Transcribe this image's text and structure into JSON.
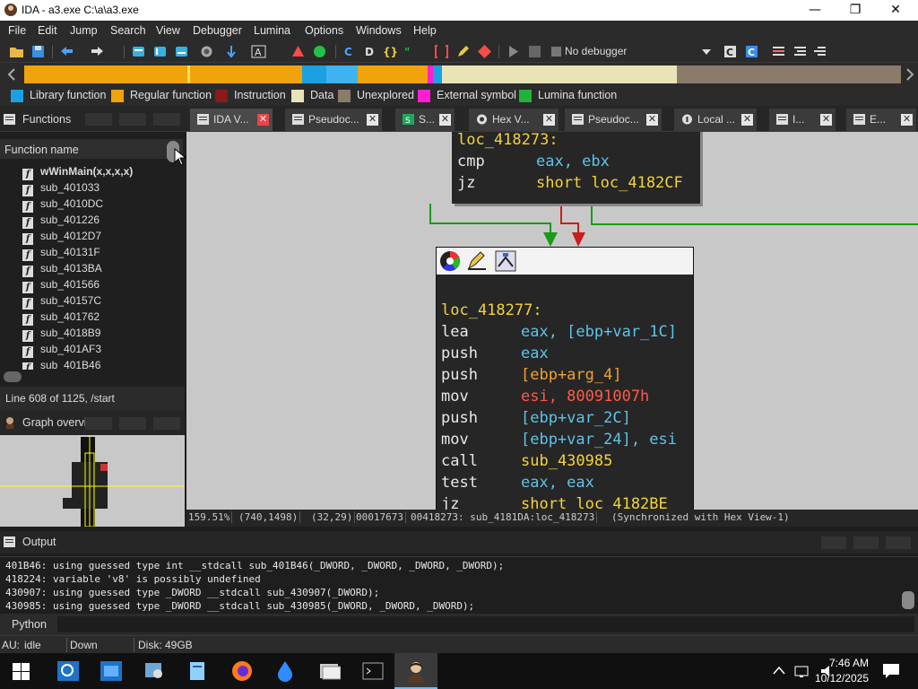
{
  "window": {
    "title": "IDA - a3.exe C:\\a\\a3.exe",
    "minimize": "—",
    "maximize": "❐",
    "close": "✕"
  },
  "menu": [
    "File",
    "Edit",
    "Jump",
    "Search",
    "View",
    "Debugger",
    "Lumina",
    "Options",
    "Windows",
    "Help"
  ],
  "toolbar": {
    "debugger_select": "No debugger"
  },
  "legend": [
    {
      "label": "Library function",
      "color": "#1ba1e2"
    },
    {
      "label": "Regular function",
      "color": "#f0a30a"
    },
    {
      "label": "Instruction",
      "color": "#8b1a1a"
    },
    {
      "label": "Data",
      "color": "#e8e4b8"
    },
    {
      "label": "Unexplored",
      "color": "#8b7b6b"
    },
    {
      "label": "External symbol",
      "color": "#ff1fd0"
    },
    {
      "label": "Lumina function",
      "color": "#22b33a"
    }
  ],
  "tabs": [
    {
      "label": "IDA V..."
    },
    {
      "label": "Pseudoc..."
    },
    {
      "label": "S..."
    },
    {
      "label": "Hex V..."
    },
    {
      "label": "Pseudoc..."
    },
    {
      "label": "Local ..."
    },
    {
      "label": "I..."
    },
    {
      "label": "E..."
    }
  ],
  "functions": {
    "title": "Functions",
    "column": "Function name",
    "items": [
      "wWinMain(x,x,x,x)",
      "sub_401033",
      "sub_4010DC",
      "sub_401226",
      "sub_4012D7",
      "sub_40131F",
      "sub_4013BA",
      "sub_401566",
      "sub_40157C",
      "sub_401762",
      "sub_4018B9",
      "sub_401AF3",
      "sub_401B46"
    ],
    "line_info": "Line 608 of 1125, /start"
  },
  "graph_overview": {
    "title": "Graph overvi..."
  },
  "graph": {
    "block1": {
      "label": "loc_418273:",
      "lines": [
        {
          "mn": "cmp",
          "ops": "eax, ebx"
        },
        {
          "mn": "jz",
          "ops": "short loc_4182CF"
        }
      ]
    },
    "block2": {
      "label": "loc_418277:",
      "lines": [
        {
          "mn": "lea",
          "ops": "eax, [ebp+var_1C]"
        },
        {
          "mn": "push",
          "ops": "eax"
        },
        {
          "mn": "push",
          "ops": "[ebp+arg_4]"
        },
        {
          "mn": "mov",
          "ops": "esi, 80091007h"
        },
        {
          "mn": "push",
          "ops": "[ebp+var_2C]"
        },
        {
          "mn": "mov",
          "ops": "[ebp+var_24], esi"
        },
        {
          "mn": "call",
          "ops": "sub_430985"
        },
        {
          "mn": "test",
          "ops": "eax, eax"
        },
        {
          "mn": "jz",
          "ops": "short loc_4182BE"
        }
      ]
    },
    "status": [
      "159.51%",
      "(740,1498)",
      "(32,29)",
      "00017673",
      "00418273: sub_4181DA:loc_418273",
      "(Synchronized with Hex View-1)"
    ]
  },
  "output": {
    "title": "Output",
    "lines": [
      "401B46: using guessed type int __stdcall sub_401B46(_DWORD, _DWORD, _DWORD, _DWORD);",
      "418224: variable 'v8' is possibly undefined",
      "430907: using guessed type _DWORD __stdcall sub_430907(_DWORD);",
      "430985: using guessed type _DWORD __stdcall sub_430985(_DWORD, _DWORD, _DWORD);"
    ],
    "input_label": "Python"
  },
  "status": {
    "au": "AU:",
    "au_state": "idle",
    "direction": "Down",
    "disk": "Disk: 49GB"
  },
  "taskbar": {
    "time": "7:46 AM",
    "date": "10/12/2025"
  }
}
